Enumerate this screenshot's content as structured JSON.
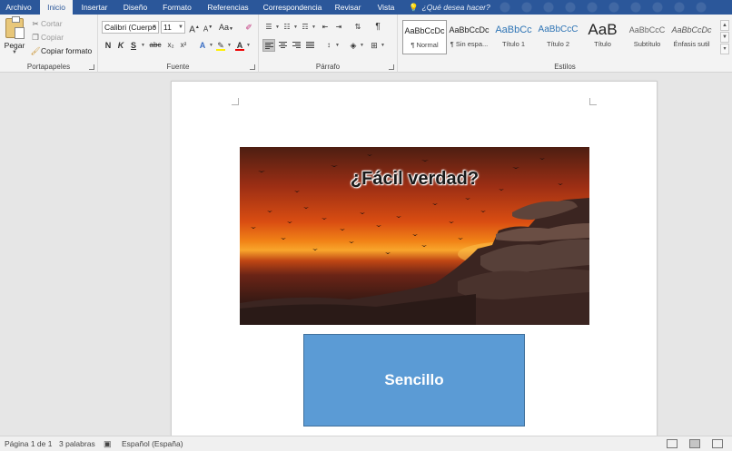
{
  "tabs": [
    {
      "label": "Archivo",
      "active": false
    },
    {
      "label": "Inicio",
      "active": true
    },
    {
      "label": "Insertar",
      "active": false
    },
    {
      "label": "Diseño",
      "active": false
    },
    {
      "label": "Formato",
      "active": false
    },
    {
      "label": "Referencias",
      "active": false
    },
    {
      "label": "Correspondencia",
      "active": false
    },
    {
      "label": "Revisar",
      "active": false
    },
    {
      "label": "Vista",
      "active": false
    }
  ],
  "tell_me": {
    "placeholder": "¿Qué desea hacer?"
  },
  "clipboard": {
    "paste_label": "Pegar",
    "cut_label": "Cortar",
    "copy_label": "Copiar",
    "format_painter_label": "Copiar formato",
    "group_label": "Portapapeles"
  },
  "font": {
    "font_name": "Calibri (Cuerpo",
    "font_size": "11",
    "bold": "N",
    "italic": "K",
    "underline": "S",
    "strikethrough": "abc",
    "subscript": "x₂",
    "superscript": "x²",
    "grow": "A",
    "shrink": "A",
    "case": "Aa",
    "text_effects": "A",
    "font_color": "A",
    "group_label": "Fuente"
  },
  "paragraph": {
    "group_label": "Párrafo"
  },
  "styles": {
    "items": [
      {
        "sample": "AaBbCcDc",
        "name": "¶ Normal",
        "selected": true
      },
      {
        "sample": "AaBbCcDc",
        "name": "¶ Sin espa...",
        "selected": false
      },
      {
        "sample": "AaBbCc",
        "name": "Título 1",
        "selected": false
      },
      {
        "sample": "AaBbCcC",
        "name": "Título 2",
        "selected": false
      },
      {
        "sample": "AaB",
        "name": "Título",
        "selected": false
      },
      {
        "sample": "AaBbCcC",
        "name": "Subtítulo",
        "selected": false
      },
      {
        "sample": "AaBbCcDc",
        "name": "Énfasis sutil",
        "selected": false
      }
    ],
    "group_label": "Estilos"
  },
  "document": {
    "image_caption": "¿Fácil verdad?",
    "shape_text": "Sencillo"
  },
  "status": {
    "page": "Página 1 de 1",
    "words": "3 palabras",
    "language": "Español (España)"
  },
  "colors": {
    "accent": "#2b579a",
    "shape_fill": "#5b9bd5",
    "shape_border": "#41719c"
  }
}
